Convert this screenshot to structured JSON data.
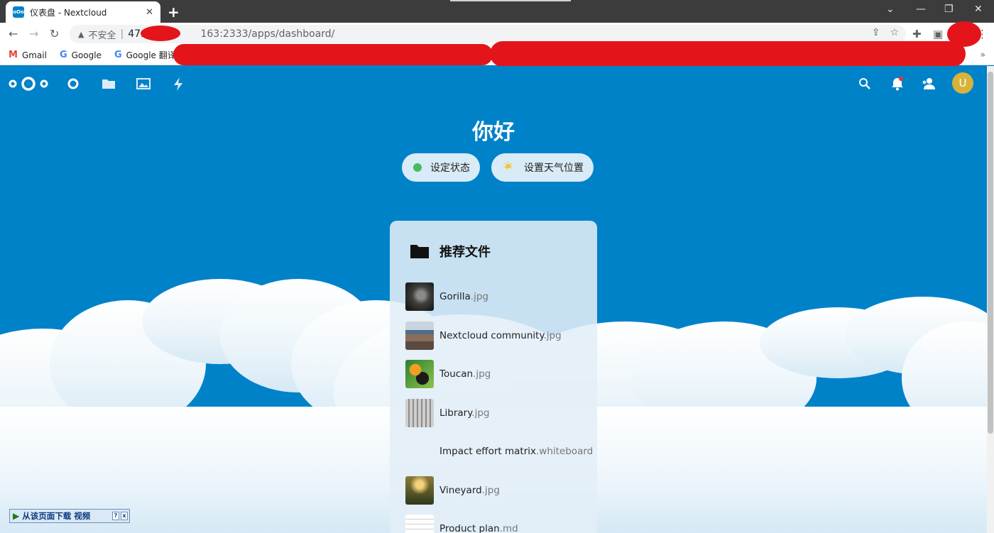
{
  "browser": {
    "tab_title": "仪表盘 - Nextcloud",
    "tab_close": "✕",
    "new_tab": "+",
    "url_insecure_label": "不安全",
    "url_sep": "|",
    "url_prefix": "47.",
    "url_rest": "163:2333/apps/dashboard/",
    "bookmarks": [
      {
        "label": "Gmail",
        "icon": "M",
        "icon_color": "#ea4335"
      },
      {
        "label": "Google",
        "icon": "G",
        "icon_color": "#4285f4"
      },
      {
        "label": "Google 翻译",
        "icon": "G",
        "icon_color": "#4285f4"
      }
    ],
    "bookmarks_more": "»"
  },
  "dashboard": {
    "greeting": "你好",
    "status_button": "设定状态",
    "weather_button": "设置天气位置",
    "panel_title": "推荐文件",
    "files": [
      {
        "name": "Gorilla",
        "ext": ".jpg",
        "thumb": "gorilla"
      },
      {
        "name": "Nextcloud community",
        "ext": ".jpg",
        "thumb": "community"
      },
      {
        "name": "Toucan",
        "ext": ".jpg",
        "thumb": "toucan"
      },
      {
        "name": "Library",
        "ext": ".jpg",
        "thumb": "library"
      },
      {
        "name": "Impact effort matrix",
        "ext": ".whiteboard",
        "thumb": "none"
      },
      {
        "name": "Vineyard",
        "ext": ".jpg",
        "thumb": "vineyard"
      },
      {
        "name": "Product plan",
        "ext": ".md",
        "thumb": "document"
      }
    ]
  },
  "user": {
    "avatar_letter": "U",
    "avatar_color": "#d8b33a"
  },
  "download_bar": {
    "label": "从该页面下载 视频",
    "help": "?",
    "close": "x"
  },
  "colors": {
    "nextcloud_blue": "#0082c9",
    "status_online": "#46ba61"
  }
}
